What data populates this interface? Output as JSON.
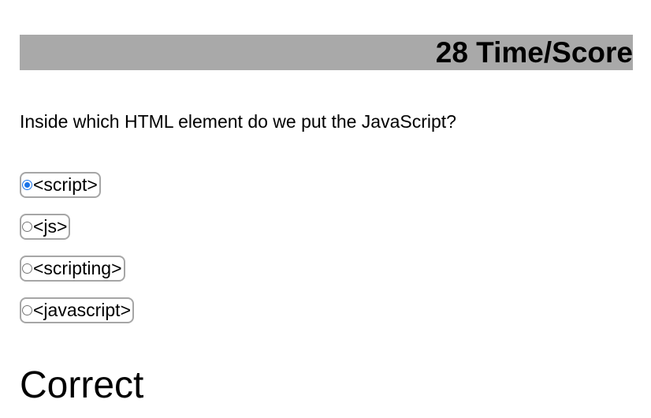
{
  "header": {
    "text": "28 Time/Score",
    "background_color": "#a9a9a9"
  },
  "question": {
    "text": "Inside which HTML element do we put the JavaScript?"
  },
  "answers": [
    {
      "label": "<script>",
      "selected": true
    },
    {
      "label": "<js>",
      "selected": false
    },
    {
      "label": "<scripting>",
      "selected": false
    },
    {
      "label": "<javascript>",
      "selected": false
    }
  ],
  "result": {
    "text": "Correct"
  },
  "colors": {
    "radio_selected": "#1a73e8",
    "answer_border": "#a6a6a6"
  }
}
